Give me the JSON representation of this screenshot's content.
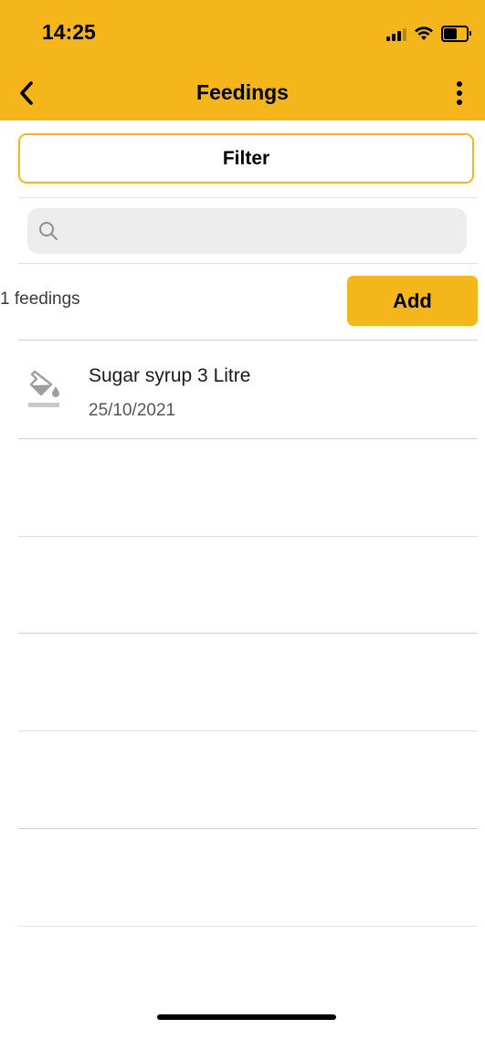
{
  "status_bar": {
    "time": "14:25",
    "icons": [
      "signal-icon",
      "wifi-icon",
      "battery-icon"
    ]
  },
  "nav": {
    "title": "Feedings",
    "back_icon": "chevron-left-icon",
    "menu_icon": "more-vertical-icon"
  },
  "filter": {
    "label": "Filter"
  },
  "search": {
    "placeholder": "",
    "value": ""
  },
  "summary": {
    "count_label": "1 feedings",
    "add_label": "Add"
  },
  "feedings": [
    {
      "title": "Sugar syrup 3 Litre",
      "date": "25/10/2021",
      "icon": "paint-bucket-icon"
    }
  ],
  "colors": {
    "accent": "#F5B61C",
    "search_bg": "#EDEDEE",
    "divider": "#E2E2E2",
    "icon_gray": "#9E9E9E"
  }
}
